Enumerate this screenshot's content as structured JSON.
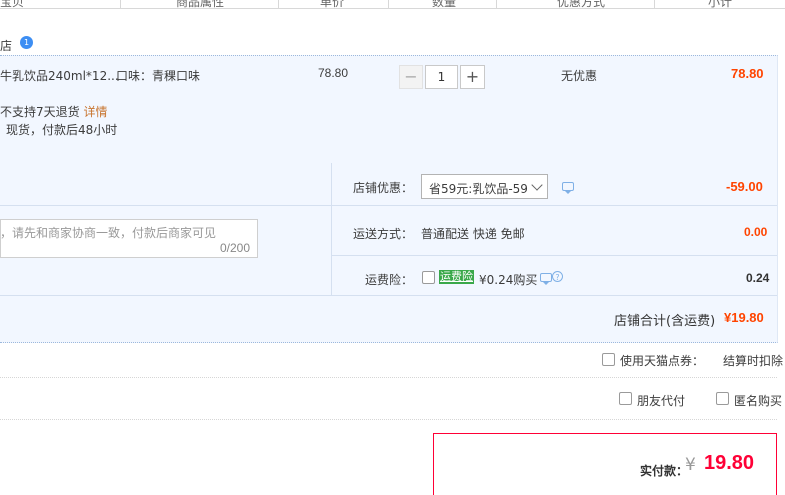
{
  "header": {
    "col_product": "宝贝",
    "col_attrs": "商品属性",
    "col_price": "单价",
    "col_qty": "数量",
    "col_discount": "优惠方式",
    "col_subtotal": "小计"
  },
  "shop": {
    "name": "店",
    "badge": "1"
  },
  "item": {
    "title": "牛乳饮品240ml*12...",
    "sku": "口味：青稞口味",
    "price": "78.80",
    "qty": "1",
    "minus": "−",
    "plus": "+",
    "discount": "无优惠",
    "subtotal": "78.80",
    "return_note": "不支持7天退货",
    "return_link": "详情",
    "delivery_note": "现货，付款后48小时"
  },
  "options": {
    "shop_coupon_label": "店铺优惠：",
    "shop_coupon_value": "省59元:乳饮品-59",
    "shop_coupon_amount": "-59.00",
    "message_placeholder": "，请先和商家协商一致，付款后商家可见",
    "message_count": "0/200",
    "shipping_label": "运送方式：",
    "shipping_value": "普通配送 快递 免邮",
    "shipping_amount": "0.00",
    "insurance_label": "运费险：",
    "insurance_badge": "运费险",
    "insurance_price": "¥0.24购买",
    "insurance_amount": "0.24",
    "total_label": "店铺合计(含运费)",
    "total_amount": "¥19.80"
  },
  "extras": {
    "tmall_points_label": "使用天猫点券：",
    "tmall_points_note": "结算时扣除",
    "friend_pay_label": "朋友代付",
    "anonymous_label": "匿名购买"
  },
  "payment": {
    "label": "实付款：",
    "currency": "¥",
    "amount": "19.80"
  },
  "colors": {
    "accent": "#ff4400",
    "pay_red": "#ff0036",
    "panel_bg": "#f2f7ff",
    "insurance_green": "#3aa84a"
  }
}
